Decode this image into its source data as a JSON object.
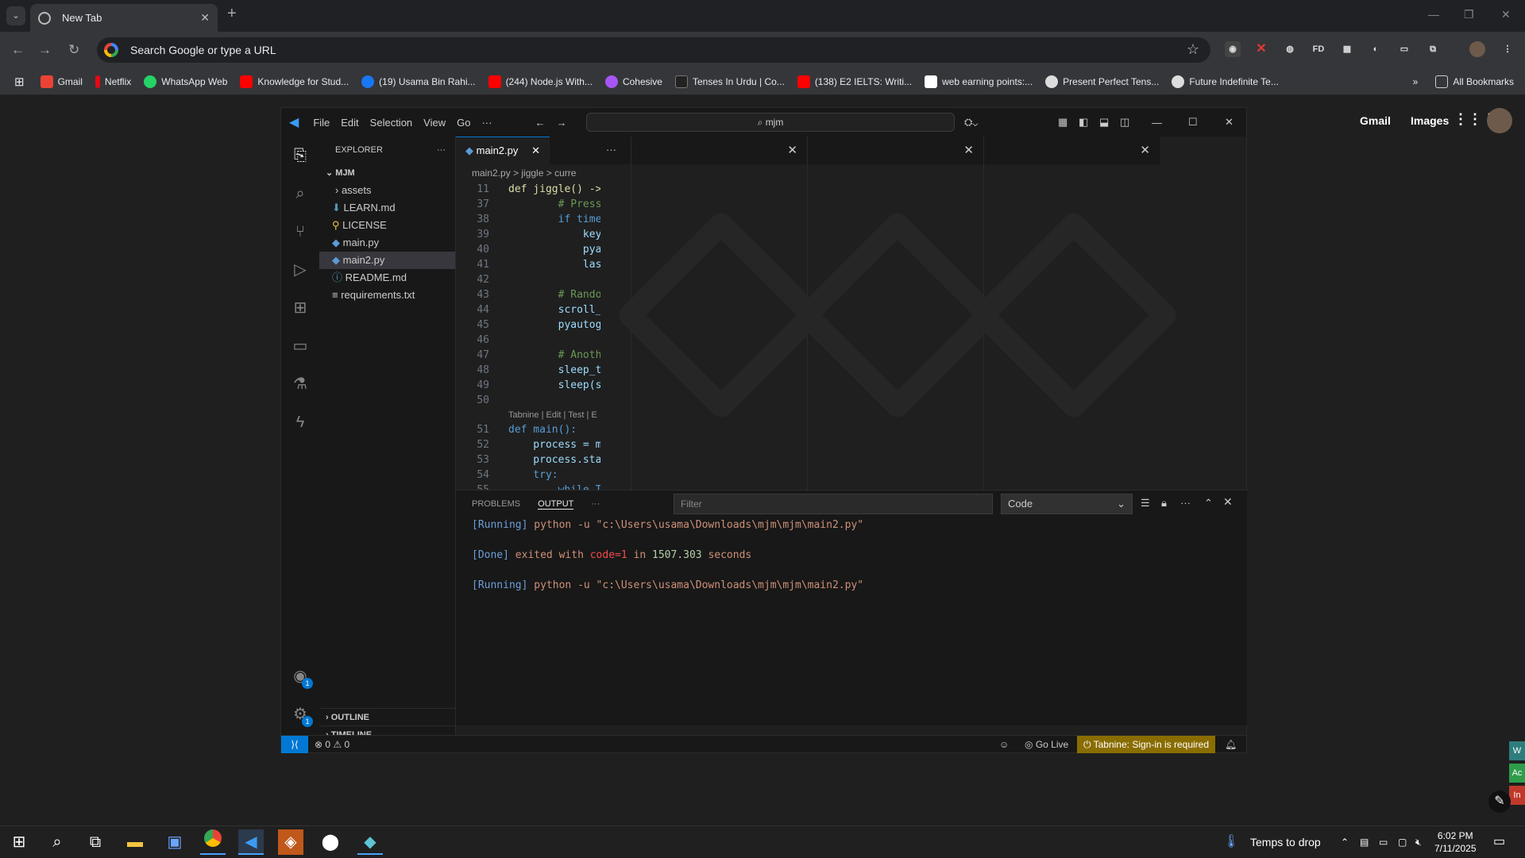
{
  "browser": {
    "tab_title": "New Tab",
    "omnibox_placeholder": "Search Google or type a URL",
    "all_bookmarks": "All Bookmarks",
    "ext_fd": "FD",
    "bookmarks": [
      "Gmail",
      "Netflix",
      "WhatsApp Web",
      "Knowledge for Stud...",
      "(19) Usama Bin Rahi...",
      "(244) Node.js With...",
      "Cohesive",
      "Tenses In Urdu | Co...",
      "(138) E2 IELTS: Writi...",
      "web earning points:...",
      "Present Perfect Tens...",
      "Future Indefinite Te..."
    ],
    "ntp_gmail": "Gmail",
    "ntp_images": "Images"
  },
  "vscode": {
    "menus": [
      "File",
      "Edit",
      "Selection",
      "View",
      "Go",
      "···"
    ],
    "search": "mjm",
    "explorer": {
      "title": "EXPLORER",
      "root": "MJM",
      "files": [
        "assets",
        "LEARN.md",
        "LICENSE",
        "main.py",
        "main2.py",
        "README.md",
        "requirements.txt"
      ],
      "outline": "OUTLINE",
      "timeline": "TIMELINE",
      "selected": "main2.py"
    },
    "tab": "main2.py",
    "breadcrumb": "main2.py > jiggle > curre",
    "sticky": {
      "n": "11",
      "text": "def jiggle() ->"
    },
    "codelens": "Tabnine | Edit | Test | E",
    "lines": [
      {
        "n": "37",
        "t": "        # Press"
      },
      {
        "n": "38",
        "t": "        if time"
      },
      {
        "n": "39",
        "t": "            key"
      },
      {
        "n": "40",
        "t": "            pya"
      },
      {
        "n": "41",
        "t": "            las"
      },
      {
        "n": "42",
        "t": ""
      },
      {
        "n": "43",
        "t": "        # Rando"
      },
      {
        "n": "44",
        "t": "        scroll_"
      },
      {
        "n": "45",
        "t": "        pyautog"
      },
      {
        "n": "46",
        "t": ""
      },
      {
        "n": "47",
        "t": "        # Anoth"
      },
      {
        "n": "48",
        "t": "        sleep_t"
      },
      {
        "n": "49",
        "t": "        sleep(s"
      },
      {
        "n": "50",
        "t": ""
      }
    ],
    "lines2": [
      {
        "n": "51",
        "t": "def main():"
      },
      {
        "n": "52",
        "t": "    process = m"
      },
      {
        "n": "53",
        "t": "    process.sta"
      },
      {
        "n": "54",
        "t": "    try:"
      },
      {
        "n": "55",
        "t": "        while T"
      }
    ],
    "panel": {
      "tabs": [
        "PROBLEMS",
        "OUTPUT"
      ],
      "filter_placeholder": "Filter",
      "channel": "Code",
      "output": [
        "[Running] python -u \"c:\\Users\\usama\\Downloads\\mjm\\mjm\\main2.py\"",
        "",
        "[Done] exited with code=1 in 1507.303 seconds",
        "",
        "[Running] python -u \"c:\\Users\\usama\\Downloads\\mjm\\mjm\\main2.py\""
      ]
    },
    "status": {
      "errors": "0",
      "warnings": "0",
      "golive": "Go Live",
      "tabnine": "Tabnine: Sign-in is required"
    },
    "badges": {
      "accounts": "1",
      "settings": "1"
    }
  },
  "taskbar": {
    "weather": "Temps to drop",
    "time": "6:02 PM",
    "date": "7/11/2025"
  },
  "edge_buttons": [
    "W",
    "Ac",
    "In"
  ]
}
